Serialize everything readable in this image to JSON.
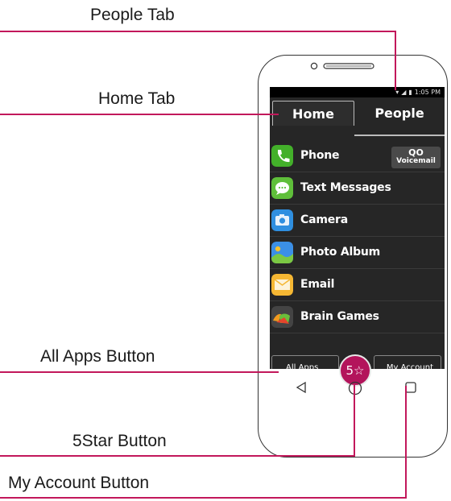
{
  "callouts": {
    "people_tab": "People Tab",
    "home_tab": "Home Tab",
    "all_apps_button": "All Apps Button",
    "fivestar_button": "5Star Button",
    "my_account_button": "My Account Button"
  },
  "status_bar": {
    "time": "1:05 PM"
  },
  "tabs": {
    "home": "Home",
    "people": "People"
  },
  "apps": [
    {
      "label": "Phone",
      "icon": "phone-icon"
    },
    {
      "label": "Text Messages",
      "icon": "chat-icon"
    },
    {
      "label": "Camera",
      "icon": "camera-icon"
    },
    {
      "label": "Photo Album",
      "icon": "photo-icon"
    },
    {
      "label": "Email",
      "icon": "email-icon"
    },
    {
      "label": "Brain Games",
      "icon": "brain-games-icon"
    }
  ],
  "voicemail": {
    "symbol": "QO",
    "label": "Voicemail"
  },
  "bottom_bar": {
    "all_apps": "All Apps",
    "fivestar": "5☆",
    "my_account": "My Account"
  },
  "colors": {
    "callout_line": "#c2185b",
    "star_button": "#b3145b"
  }
}
